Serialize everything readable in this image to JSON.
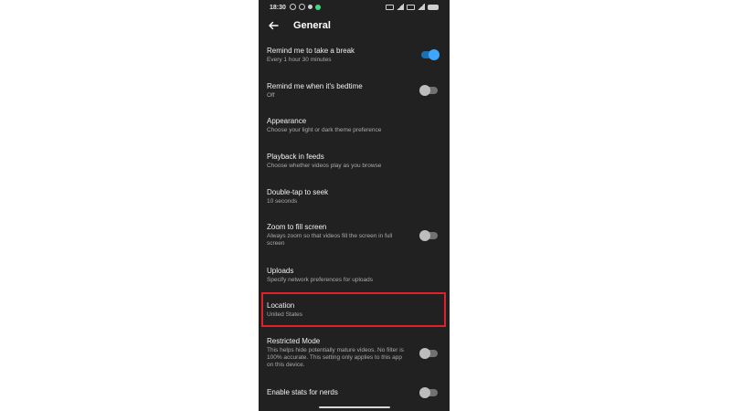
{
  "status_bar": {
    "time": "18:30"
  },
  "header": {
    "title": "General"
  },
  "settings": [
    {
      "title": "Remind me to take a break",
      "subtitle": "Every 1 hour 30 minutes",
      "toggle": "on"
    },
    {
      "title": "Remind me when it's bedtime",
      "subtitle": "Off",
      "toggle": "off"
    },
    {
      "title": "Appearance",
      "subtitle": "Choose your light or dark theme preference"
    },
    {
      "title": "Playback in feeds",
      "subtitle": "Choose whether videos play as you browse"
    },
    {
      "title": "Double-tap to seek",
      "subtitle": "10 seconds"
    },
    {
      "title": "Zoom to fill screen",
      "subtitle": "Always zoom so that videos fill the screen in full screen",
      "toggle": "off"
    },
    {
      "title": "Uploads",
      "subtitle": "Specify network preferences for uploads"
    },
    {
      "title": "Location",
      "subtitle": "United States",
      "highlighted": true
    },
    {
      "title": "Restricted Mode",
      "subtitle": "This helps hide potentially mature videos. No filter is 100% accurate. This setting only applies to this app on this device.",
      "toggle": "off"
    },
    {
      "title": "Enable stats for nerds",
      "toggle": "off"
    }
  ],
  "colors": {
    "background": "#212121",
    "toggle_on": "#3ea6ff",
    "highlight": "#e0202c"
  }
}
